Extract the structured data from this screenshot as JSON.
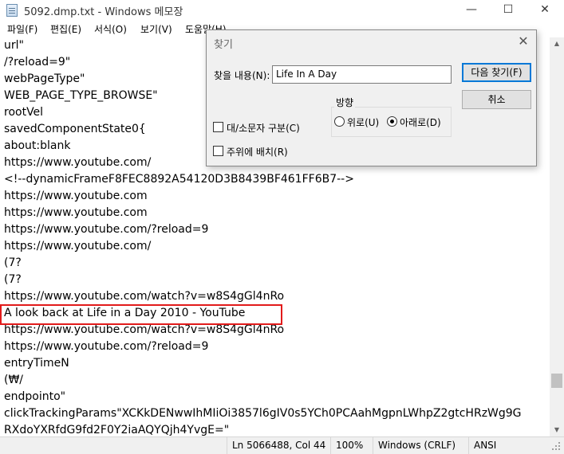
{
  "window": {
    "title": "5092.dmp.txt - Windows 메모장",
    "minimize_glyph": "—",
    "maximize_glyph": "☐",
    "close_glyph": "✕"
  },
  "menu": [
    "파일(F)",
    "편집(E)",
    "서식(O)",
    "보기(V)",
    "도움말(H)"
  ],
  "editor": {
    "lines": [
      "url\"",
      "/?reload=9\"",
      "webPageType\"",
      "WEB_PAGE_TYPE_BROWSE\"",
      "rootVel",
      "savedComponentState0{",
      "about:blank",
      "https://www.youtube.com/",
      "<!--dynamicFrameF8FEC8892A54120D3B8439BF461FF6B7-->",
      "https://www.youtube.com",
      "https://www.youtube.com",
      "https://www.youtube.com/?reload=9",
      "https://www.youtube.com/",
      "(7?",
      "(7?",
      "https://www.youtube.com/watch?v=w8S4gGl4nRo",
      "A look back at Life in a Day 2010 - YouTube",
      "https://www.youtube.com/watch?v=w8S4gGl4nRo",
      "https://www.youtube.com/?reload=9",
      "entryTimeN",
      "(₩/",
      "endpointo\"",
      "clickTrackingParams\"XCKkDENwwIhMIiOi3857l6gIV0s5YCh0PCAahMgpnLWhpZ2gtcHRzWg9G",
      "RXdoYXRfdG9fd2F0Y2iaAQYQjh4YvgE=\""
    ],
    "highlighted_line_index": 16,
    "scroll_position_fraction": 0.9
  },
  "status": {
    "position": "Ln 5066488, Col 44",
    "zoom": "100%",
    "line_ending": "Windows (CRLF)",
    "encoding": "ANSI"
  },
  "find_dialog": {
    "title": "찾기",
    "close_glyph": "✕",
    "find_label": "찾을 내용(N):",
    "find_value": "Life In A Day",
    "find_next_button": "다음 찾기(F)",
    "cancel_button": "취소",
    "direction_label": "방향",
    "direction_up": "위로(U)",
    "direction_down": "아래로(D)",
    "direction_selected": "down",
    "match_case": "대/소문자 구분(C)",
    "match_case_checked": false,
    "wrap_around": "주위에 배치(R)",
    "wrap_around_checked": false
  }
}
